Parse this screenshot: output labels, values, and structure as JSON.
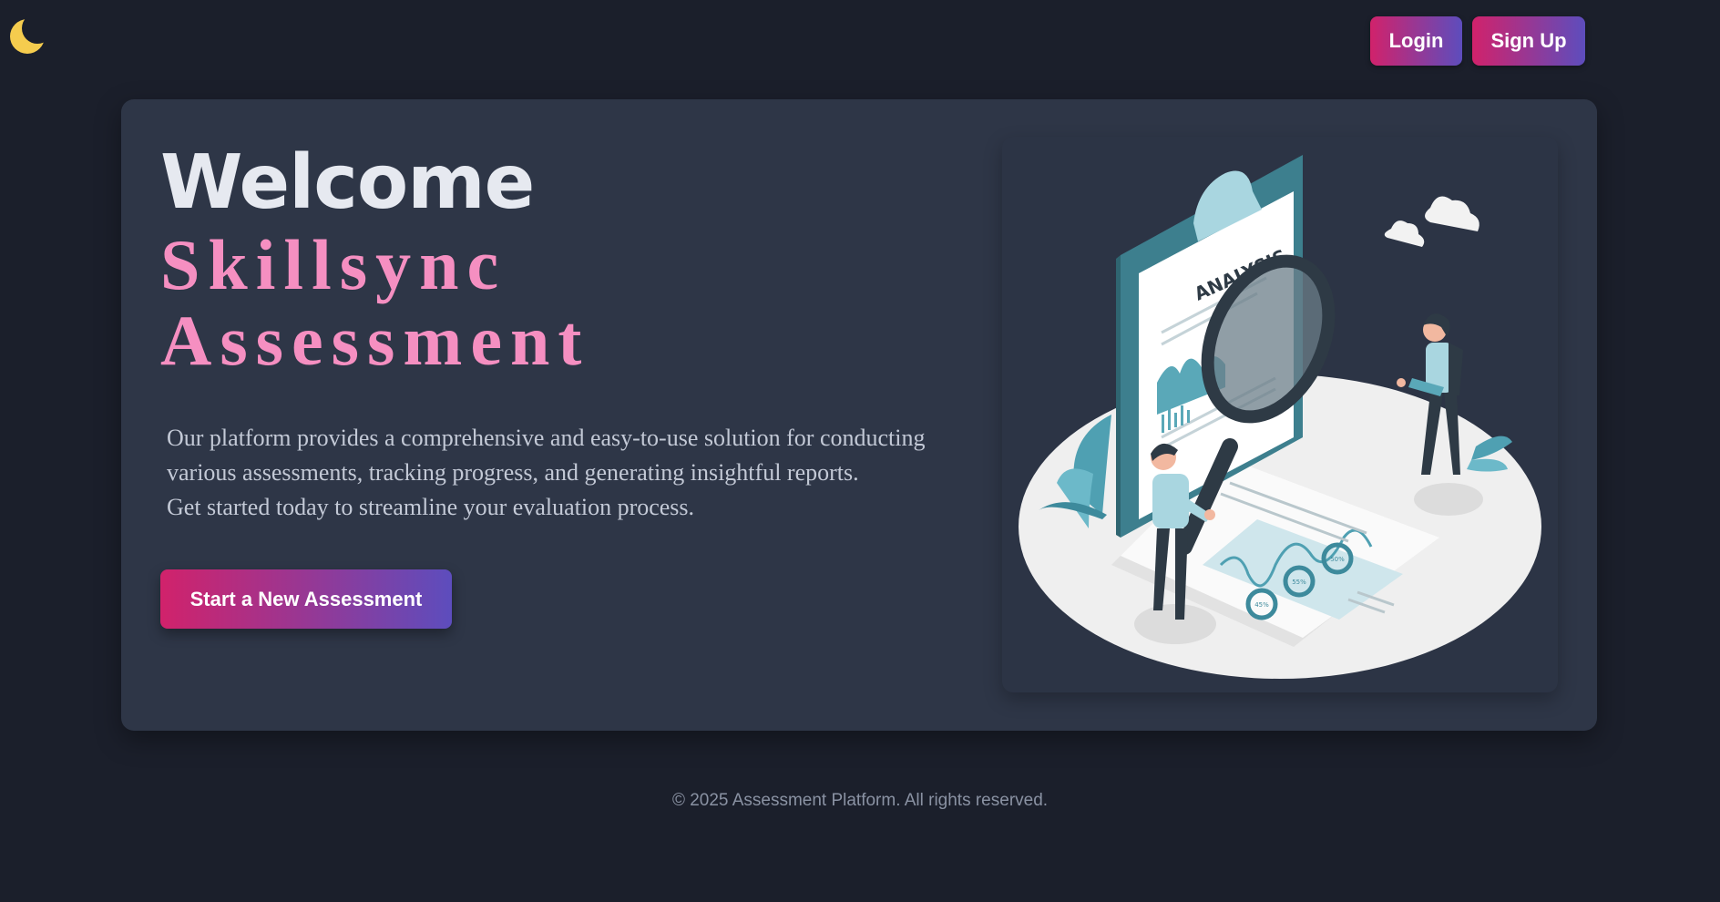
{
  "header": {
    "theme_toggle_icon": "moon-icon",
    "login_label": "Login",
    "signup_label": "Sign Up"
  },
  "hero": {
    "welcome": "Welcome",
    "brand_line_1": "Skillsync",
    "brand_line_2": "Assessment",
    "description_lines": [
      "Our platform provides a comprehensive and easy-to-use solution for conducting",
      "various assessments, tracking progress, and generating insightful reports.",
      "Get started today to streamline your evaluation process."
    ],
    "cta_label": "Start a New Assessment",
    "illustration": {
      "clipboard_label": "ANALYSIS",
      "badges": [
        "50%",
        "55%",
        "45%"
      ]
    }
  },
  "footer": {
    "copyright": "© 2025 Assessment Platform. All rights reserved."
  },
  "colors": {
    "background": "#1b1f2b",
    "card": "#2e3647",
    "accent_pink": "#f58fc1",
    "gradient_start": "#d1226b",
    "gradient_end": "#5d4dbd",
    "moon": "#f5cc4e"
  }
}
